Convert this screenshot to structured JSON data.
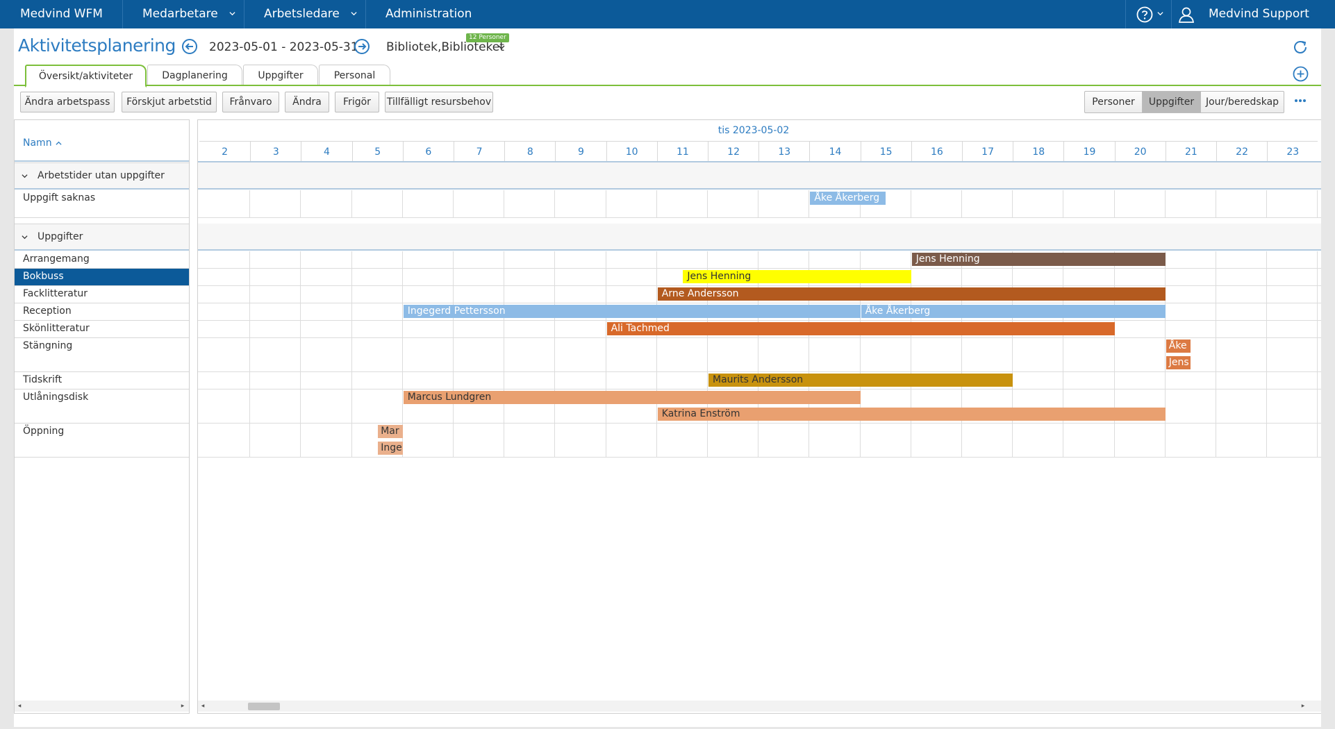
{
  "topnav": {
    "brand": "Medvind WFM",
    "items": [
      {
        "label": "Medarbetare"
      },
      {
        "label": "Arbetsledare"
      },
      {
        "label": "Administration"
      }
    ],
    "user": "Medvind Support"
  },
  "header": {
    "title": "Aktivitetsplanering",
    "date_range": "2023-05-01 - 2023-05-31",
    "unit": "Bibliotek,Biblioteket",
    "badge": "12 Personer"
  },
  "tabs": [
    {
      "label": "Översikt/aktiviteter",
      "active": true
    },
    {
      "label": "Dagplanering",
      "active": false
    },
    {
      "label": "Uppgifter",
      "active": false
    },
    {
      "label": "Personal",
      "active": false
    }
  ],
  "toolbar": {
    "buttons": [
      "Ändra arbetspass",
      "Förskjut arbetstid",
      "Frånvaro",
      "Ändra",
      "Frigör",
      "Tillfälligt resursbehov"
    ],
    "view_segments": [
      {
        "label": "Personer",
        "active": false
      },
      {
        "label": "Uppgifter",
        "active": true
      },
      {
        "label": "Jour/beredskap",
        "active": false
      }
    ]
  },
  "left": {
    "name_header": "Namn",
    "groups": [
      {
        "label": "Arbetstider utan uppgifter",
        "rows": [
          "Uppgift saknas"
        ]
      },
      {
        "label": "Uppgifter",
        "rows": [
          "Arrangemang",
          "Bokbuss",
          "Facklitteratur",
          "Reception",
          "Skönlitteratur",
          "Stängning",
          "Tidskrift",
          "Utlåningsdisk",
          "Öppning"
        ]
      }
    ],
    "selected_row": "Bokbuss"
  },
  "grid": {
    "date_label": "tis 2023-05-02",
    "hours": [
      "2",
      "3",
      "4",
      "5",
      "6",
      "7",
      "8",
      "9",
      "10",
      "11",
      "12",
      "13",
      "14",
      "15",
      "16",
      "17",
      "18",
      "19",
      "20",
      "21",
      "22",
      "23"
    ],
    "bars": [
      {
        "label": "Åke Åkerberg",
        "row": "Uppgift saknas",
        "lane": 0,
        "start": 14.0,
        "end": 15.5,
        "color": "#8dbbe6",
        "text_color": "#ffffff"
      },
      {
        "label": "Jens Henning",
        "row": "Arrangemang",
        "lane": 0,
        "start": 16.0,
        "end": 21.0,
        "color": "#7b5b4a",
        "text_color": "#ffffff"
      },
      {
        "label": "Jens Henning",
        "row": "Bokbuss",
        "lane": 0,
        "start": 11.5,
        "end": 16.0,
        "color": "#ffff00",
        "text_color": "#333333"
      },
      {
        "label": "Arne Andersson",
        "row": "Facklitteratur",
        "lane": 0,
        "start": 11.0,
        "end": 21.0,
        "color": "#b35a1f",
        "text_color": "#ffffff"
      },
      {
        "label": "Ingegerd Pettersson",
        "row": "Reception",
        "lane": 0,
        "start": 6.0,
        "end": 15.0,
        "color": "#8dbbe6",
        "text_color": "#ffffff"
      },
      {
        "label": "Åke Åkerberg",
        "row": "Reception",
        "lane": 0,
        "start": 15.0,
        "end": 21.0,
        "color": "#8dbbe6",
        "text_color": "#ffffff"
      },
      {
        "label": "Ali Tachmed",
        "row": "Skönlitteratur",
        "lane": 0,
        "start": 10.0,
        "end": 20.0,
        "color": "#d8692a",
        "text_color": "#ffffff"
      },
      {
        "label": "Åke",
        "row": "Stängning",
        "lane": 0,
        "start": 21.0,
        "end": 21.5,
        "color": "#dc7a43",
        "text_color": "#ffffff"
      },
      {
        "label": "Jens",
        "row": "Stängning",
        "lane": 1,
        "start": 21.0,
        "end": 21.5,
        "color": "#dc7a43",
        "text_color": "#ffffff"
      },
      {
        "label": "Maurits Andersson",
        "row": "Tidskrift",
        "lane": 0,
        "start": 12.0,
        "end": 18.0,
        "color": "#c8920e",
        "text_color": "#333333"
      },
      {
        "label": "Marcus Lundgren",
        "row": "Utlåningsdisk",
        "lane": 0,
        "start": 6.0,
        "end": 15.0,
        "color": "#e9a070",
        "text_color": "#333333"
      },
      {
        "label": "Katrina Enström",
        "row": "Utlåningsdisk",
        "lane": 1,
        "start": 11.0,
        "end": 21.0,
        "color": "#e9a070",
        "text_color": "#333333"
      },
      {
        "label": "Mar",
        "row": "Öppning",
        "lane": 0,
        "start": 5.5,
        "end": 6.0,
        "color": "#eab08c",
        "text_color": "#333333"
      },
      {
        "label": "Inge",
        "row": "Öppning",
        "lane": 1,
        "start": 5.5,
        "end": 6.0,
        "color": "#eab08c",
        "text_color": "#333333"
      }
    ]
  },
  "colors": {
    "nav_bg": "#0c5a99",
    "accent_blue": "#2d7cc1",
    "tab_green": "#7cbf3a",
    "selected_row": "#0c5a99"
  }
}
